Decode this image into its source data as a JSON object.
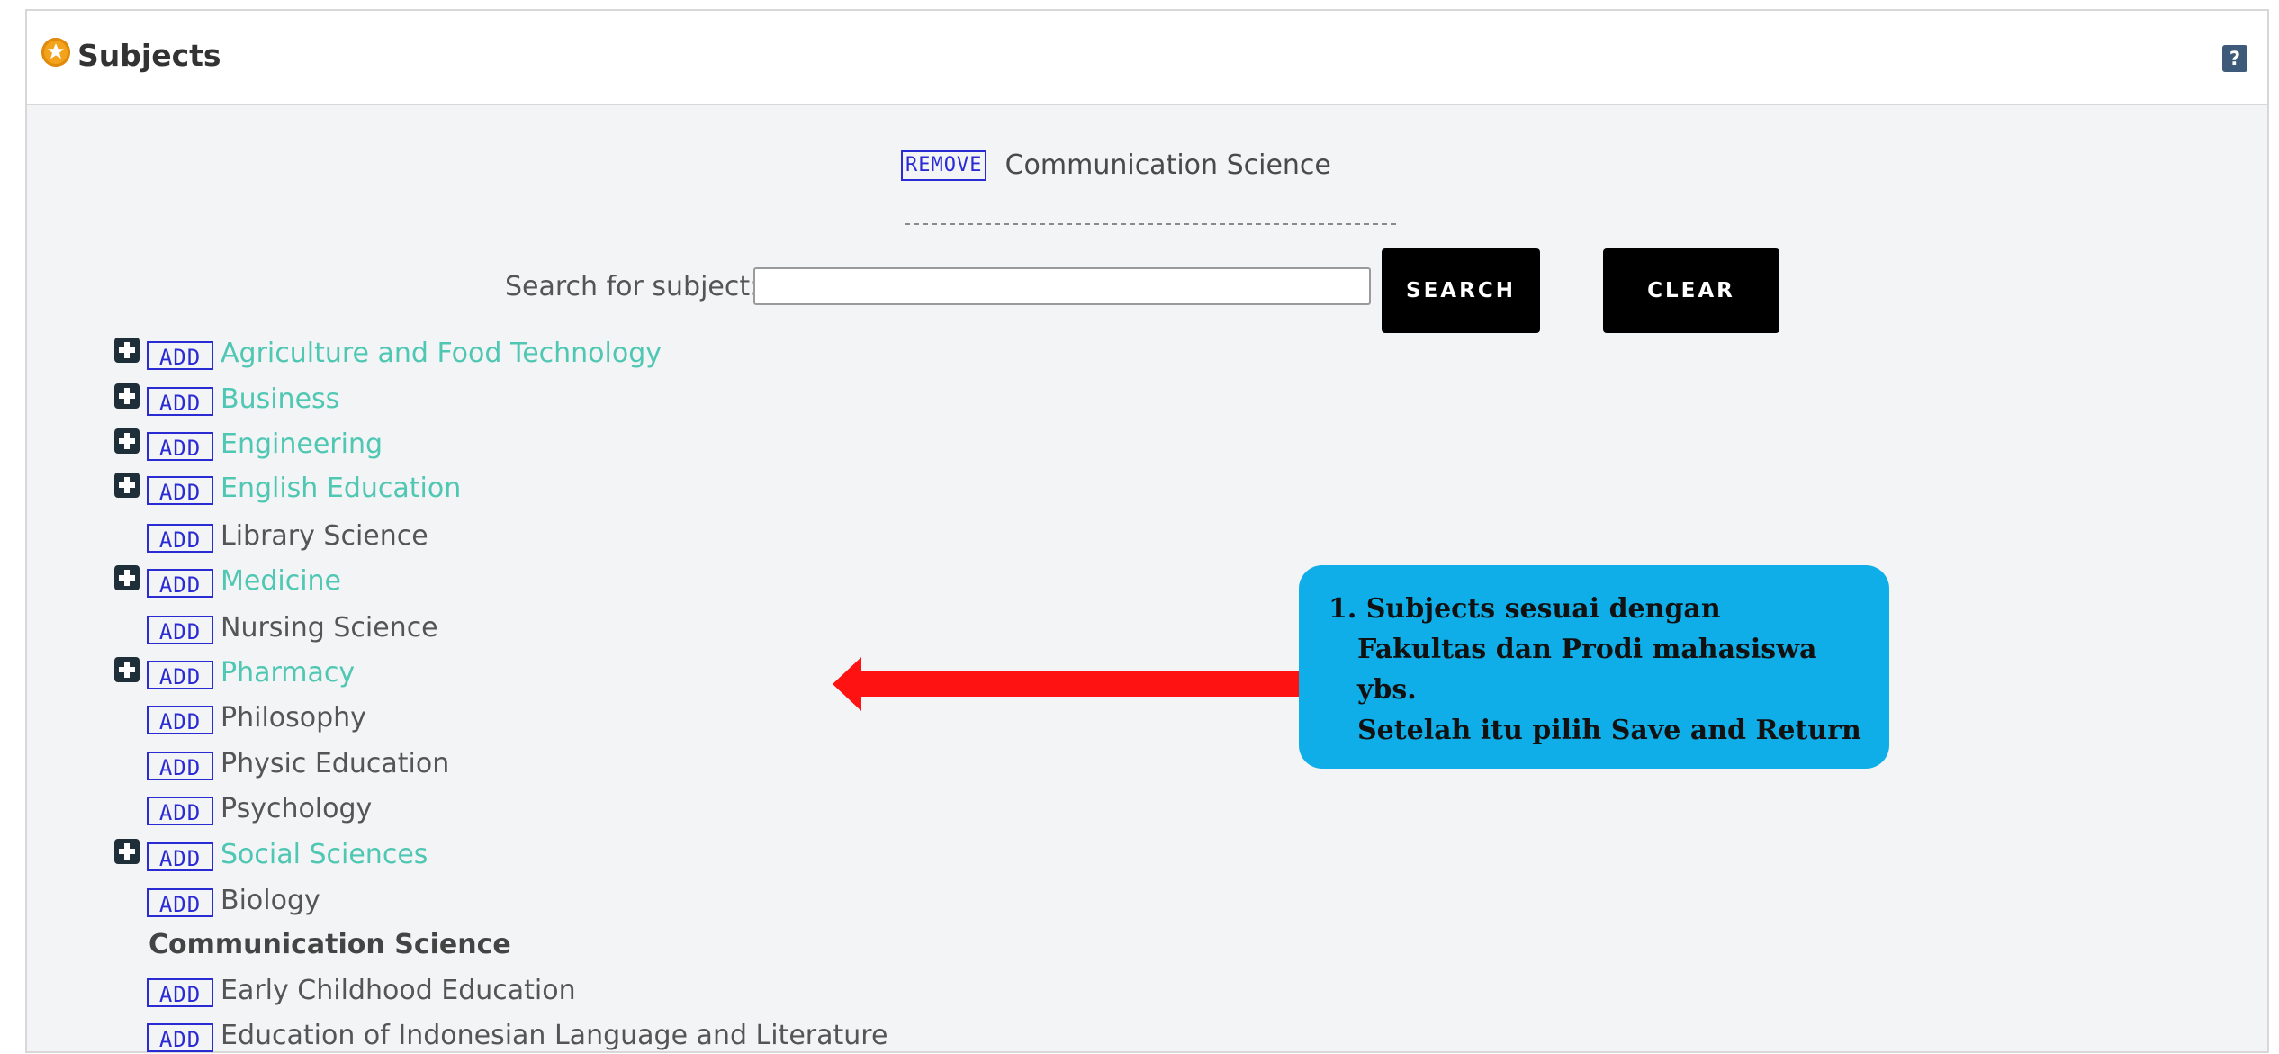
{
  "panel": {
    "title": "Subjects",
    "help_label": "?"
  },
  "selected_subject": {
    "remove_label": "REMOVE",
    "name": "Communication Science"
  },
  "search": {
    "label": "Search for subject:",
    "value": "",
    "search_button": "SEARCH",
    "clear_button": "CLEAR"
  },
  "add_label": "ADD",
  "tree": [
    {
      "label": "Agriculture and Food Technology",
      "expandable": true
    },
    {
      "label": "Business",
      "expandable": true
    },
    {
      "label": "Engineering",
      "expandable": true
    },
    {
      "label": "English Education",
      "expandable": true
    },
    {
      "label": "Library Science",
      "expandable": false
    },
    {
      "label": "Medicine",
      "expandable": true
    },
    {
      "label": "Nursing Science",
      "expandable": false
    },
    {
      "label": "Pharmacy",
      "expandable": true
    },
    {
      "label": "Philosophy",
      "expandable": false
    },
    {
      "label": "Physic Education",
      "expandable": false
    },
    {
      "label": "Psychology",
      "expandable": false
    },
    {
      "label": "Social Sciences",
      "expandable": true
    },
    {
      "label": "Biology",
      "expandable": false
    },
    {
      "label": "Communication Science",
      "expandable": false,
      "selected": true
    },
    {
      "label": "Early Childhood Education",
      "expandable": false
    },
    {
      "label": "Education of Indonesian Language and Literature",
      "expandable": false
    }
  ],
  "callout": {
    "lines": [
      "1. Subjects sesuai dengan",
      "Fakultas dan Prodi mahasiswa",
      "ybs.",
      "Setelah itu pilih Save and Return"
    ]
  },
  "colors": {
    "link": "#4fc7b3",
    "add_border": "#2b2bd4",
    "callout_bg": "#10aee8",
    "arrow": "#ff1212"
  }
}
